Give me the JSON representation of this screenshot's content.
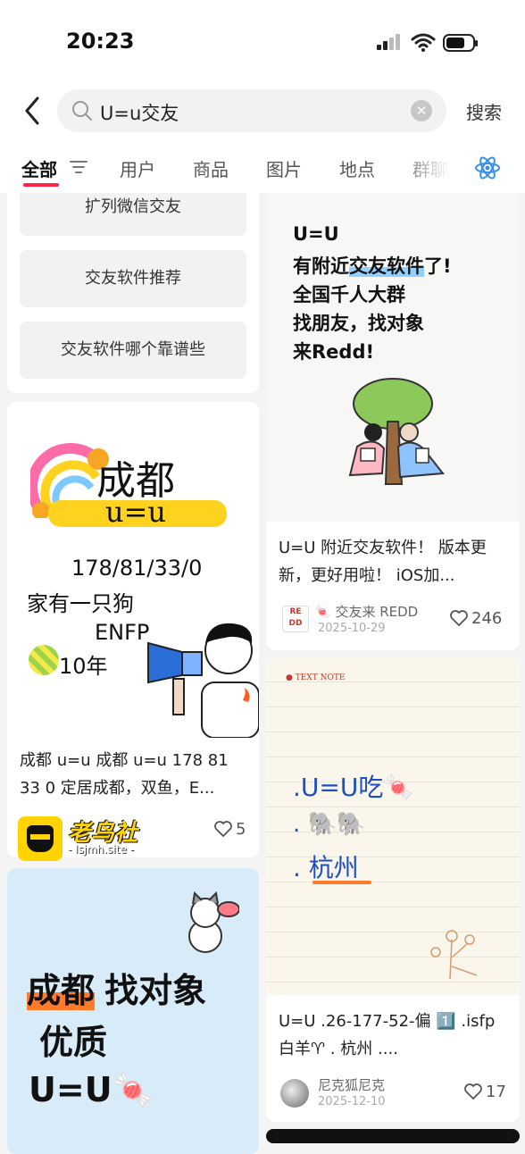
{
  "status": {
    "time": "20:23"
  },
  "search": {
    "query": "U=u交友",
    "button": "搜索"
  },
  "tabs": [
    {
      "label": "全部"
    },
    {
      "label": "用户"
    },
    {
      "label": "商品"
    },
    {
      "label": "图片"
    },
    {
      "label": "地点"
    },
    {
      "label": "群聊"
    }
  ],
  "suggestions": [
    "扩列微信交友",
    "交友软件推荐",
    "交友软件哪个靠谱些"
  ],
  "posts": {
    "p1": {
      "image_text": {
        "title": "成都",
        "tag": "u=u",
        "line1": "178/81/33/0",
        "line2": "家有一只狗",
        "line3": "ENFP",
        "line4": "10年"
      },
      "caption": "成都 u=u 成都 u=u 178 81 33 0 定居成都，双鱼，E...",
      "likes": "5"
    },
    "p2": {
      "image_text": {
        "l1": "U=U",
        "l2a": "有附近",
        "l2b": "交友软件",
        "l2c": "了!",
        "l3": "全国千人大群",
        "l4": "找朋友，找对象",
        "l5": "来Redd!"
      },
      "caption": "U=U 附近交友软件！ 版本更新，更好用啦！ iOS加...",
      "author": "🍬 交友来 REDD",
      "date": "2025-10-29",
      "likes": "246"
    },
    "p3": {
      "image_text": {
        "l1": "成都",
        "l1b": "找对象",
        "l2": "优质",
        "l3": "U=U🍬"
      }
    },
    "p4": {
      "image_text": {
        "header": "TEXT NOTE",
        "l1": ".U=U吃🍬",
        "l2": ". 🐘🐘",
        "l3": ". 杭州"
      },
      "caption": "U=U .26-177-52-偏 1️⃣ .isfp 白羊♈ . 杭州 ....",
      "author": "尼克狐尼克",
      "date": "2025-12-10",
      "likes": "17"
    }
  },
  "watermark": {
    "text": "老鸟社",
    "url": "- lsjmh.site -"
  }
}
